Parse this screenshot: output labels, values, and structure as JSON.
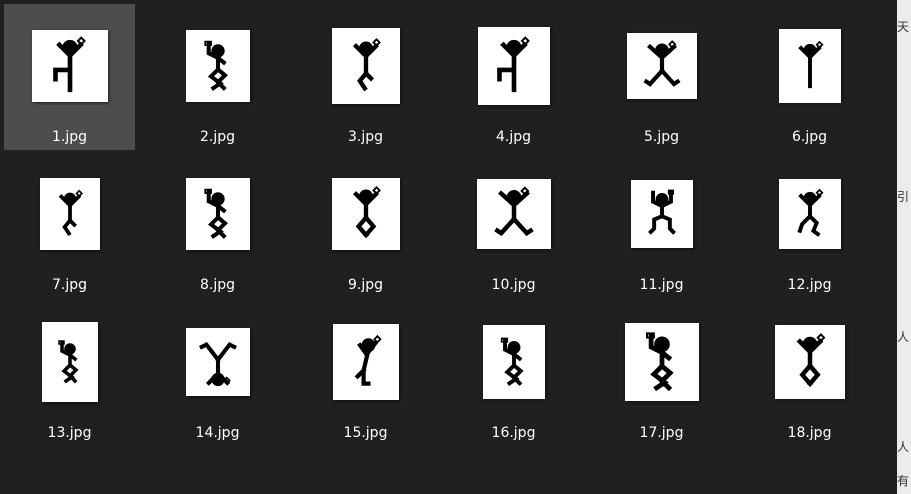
{
  "files": [
    {
      "name": "1.jpg",
      "selected": true,
      "pose": "lift-left"
    },
    {
      "name": "2.jpg",
      "pose": "wave-knees"
    },
    {
      "name": "3.jpg",
      "pose": "lift-right"
    },
    {
      "name": "4.jpg",
      "pose": "lift-left"
    },
    {
      "name": "5.jpg",
      "pose": "star"
    },
    {
      "name": "6.jpg",
      "pose": "stand"
    },
    {
      "name": "7.jpg",
      "pose": "lift-right"
    },
    {
      "name": "8.jpg",
      "pose": "wave-knees"
    },
    {
      "name": "9.jpg",
      "pose": "knees"
    },
    {
      "name": "10.jpg",
      "pose": "star"
    },
    {
      "name": "11.jpg",
      "pose": "squat"
    },
    {
      "name": "12.jpg",
      "pose": "bend-side"
    },
    {
      "name": "13.jpg",
      "pose": "wave-knees"
    },
    {
      "name": "14.jpg",
      "pose": "handstand"
    },
    {
      "name": "15.jpg",
      "pose": "lean"
    },
    {
      "name": "16.jpg",
      "pose": "wave-knees"
    },
    {
      "name": "17.jpg",
      "pose": "wave-knees"
    },
    {
      "name": "18.jpg",
      "pose": "knees"
    }
  ],
  "edge_glyphs": [
    "天",
    "引",
    "人",
    "人",
    "有"
  ]
}
